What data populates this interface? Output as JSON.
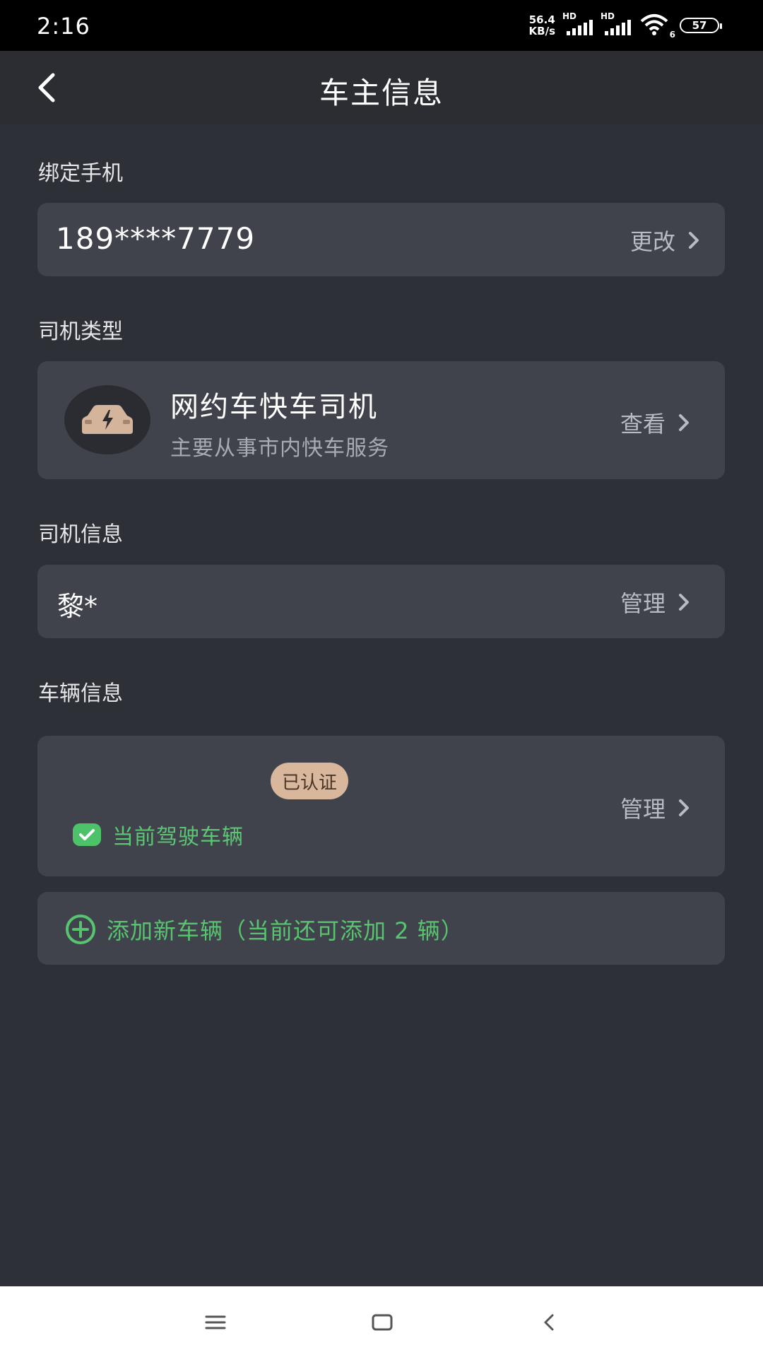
{
  "status_bar": {
    "time": "2:16",
    "net_speed_value": "56.4",
    "net_speed_unit": "KB/s",
    "signal_1_label": "HD",
    "signal_2_label": "HD",
    "wifi_badge": "6",
    "battery_level": "57"
  },
  "header": {
    "title": "车主信息"
  },
  "phone_section": {
    "label": "绑定手机",
    "value": "189****7779",
    "action": "更改"
  },
  "driver_type_section": {
    "label": "司机类型",
    "title": "网约车快车司机",
    "subtitle": "主要从事市内快车服务",
    "action": "查看"
  },
  "driver_info_section": {
    "label": "司机信息",
    "name": "黎*",
    "action": "管理"
  },
  "vehicle_section": {
    "label": "车辆信息",
    "badge": "已认证",
    "current_label": "当前驾驶车辆",
    "action": "管理",
    "add_label": "添加新车辆（当前还可添加 2 辆）"
  },
  "colors": {
    "background": "#2e3038",
    "card": "#40434c",
    "accent_green": "#5cc674",
    "badge_gold": "#d8b79d"
  }
}
